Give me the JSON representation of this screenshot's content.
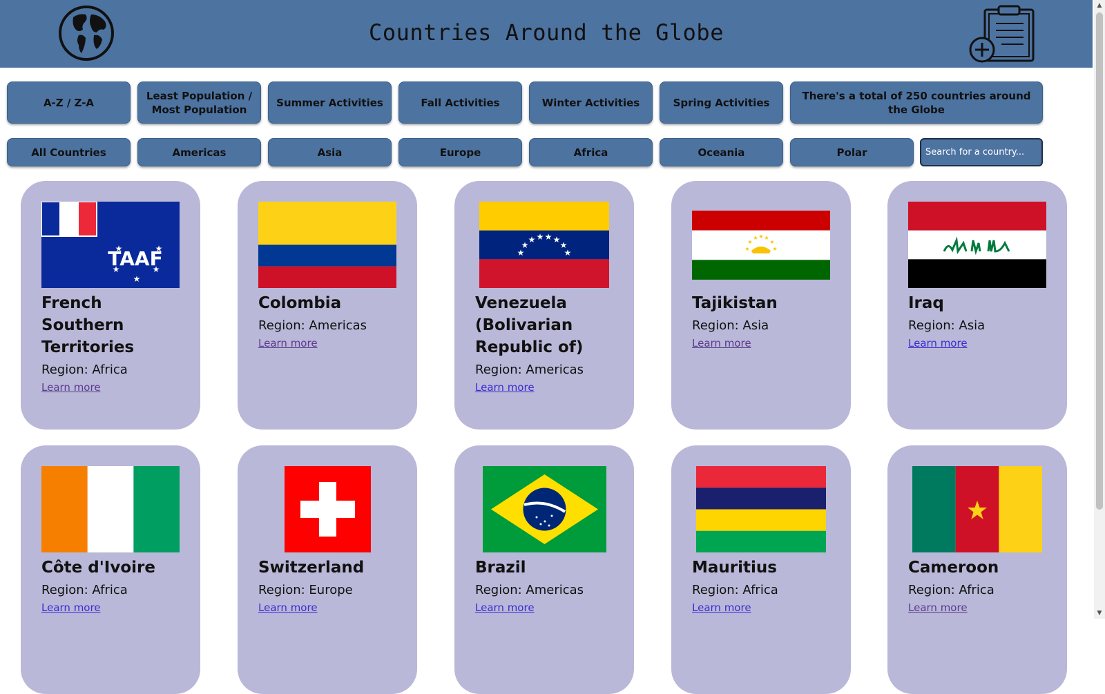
{
  "header": {
    "title": "Countries Around the Globe",
    "globe_icon": "globe-icon",
    "clipboard_icon": "clipboard-add-icon"
  },
  "sort_buttons": [
    "A-Z / Z-A",
    "Least Population / Most Population",
    "Summer Activities",
    "Fall Activities",
    "Winter Activities",
    "Spring Activities",
    "There's a total of 250 countries around the Globe"
  ],
  "region_buttons": [
    "All Countries",
    "Americas",
    "Asia",
    "Europe",
    "Africa",
    "Oceania",
    "Polar"
  ],
  "search": {
    "placeholder": "Search for a country..."
  },
  "cards": [
    {
      "name": "French Southern Territories",
      "region": "Region: Africa",
      "link": "Learn more",
      "flag": "french-southern-territories-flag"
    },
    {
      "name": "Colombia",
      "region": "Region: Americas",
      "link": "Learn more",
      "flag": "colombia-flag"
    },
    {
      "name": "Venezuela (Bolivarian Republic of)",
      "region": "Region: Americas",
      "link": "Learn more",
      "flag": "venezuela-flag"
    },
    {
      "name": "Tajikistan",
      "region": "Region: Asia",
      "link": "Learn more",
      "flag": "tajikistan-flag"
    },
    {
      "name": "Iraq",
      "region": "Region: Asia",
      "link": "Learn more",
      "flag": "iraq-flag"
    },
    {
      "name": "Côte d'Ivoire",
      "region": "Region: Africa",
      "link": "Learn more",
      "flag": "cote-divoire-flag"
    },
    {
      "name": "Switzerland",
      "region": "Region: Europe",
      "link": "Learn more",
      "flag": "switzerland-flag"
    },
    {
      "name": "Brazil",
      "region": "Region: Americas",
      "link": "Learn more",
      "flag": "brazil-flag"
    },
    {
      "name": "Mauritius",
      "region": "Region: Africa",
      "link": "Learn more",
      "flag": "mauritius-flag"
    },
    {
      "name": "Cameroon",
      "region": "Region: Africa",
      "link": "Learn more",
      "flag": "cameroon-flag"
    }
  ],
  "colors": {
    "header_bg": "#4d73a1",
    "card_bg": "#b9b8d8",
    "link": "#3b2bd0"
  }
}
